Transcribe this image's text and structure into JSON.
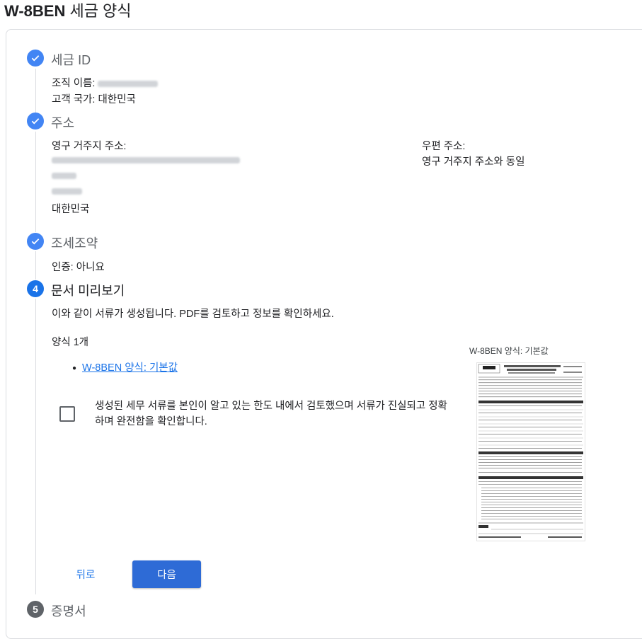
{
  "page": {
    "title_bold": "W-8BEN",
    "title_rest": " 세금 양식"
  },
  "steps": [
    {
      "title": "세금 ID"
    },
    {
      "title": "주소"
    },
    {
      "title": "조세조약"
    },
    {
      "number": "4",
      "title": "문서 미리보기"
    },
    {
      "number": "5",
      "title": "증명서"
    }
  ],
  "tax_id": {
    "org_label": "조직 이름:",
    "country_line": "고객 국가: 대한민국"
  },
  "address": {
    "permanent_label": "영구 거주지 주소:",
    "country": "대한민국",
    "mailing_label": "우편 주소:",
    "mailing_value": "영구 거주지 주소와 동일"
  },
  "treaty": {
    "cert_line": "인증: 아니요"
  },
  "preview": {
    "description": "이와 같이 서류가 생성됩니다. PDF를 검토하고 정보를 확인하세요.",
    "forms_count": "양식 1개",
    "form_link": "W-8BEN 양식: 기본값",
    "consent_text": "생성된 세무 서류를 본인이 알고 있는 한도 내에서 검토했으며 서류가 진실되고 정확하며 완전함을 확인합니다.",
    "thumbnail_caption": "W-8BEN 양식: 기본값",
    "back_label": "뒤로",
    "next_label": "다음"
  },
  "colors": {
    "accent": "#1a73e8",
    "done": "#4285f4",
    "next_button": "#2e6bd6"
  },
  "icons": {
    "done": "checkmark-icon"
  }
}
